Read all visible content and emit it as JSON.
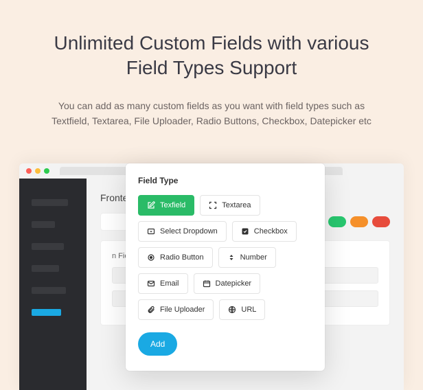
{
  "hero": {
    "title": "Unlimited Custom Fields with various Field Types Support",
    "desc": "You can add as many custom fields as you want with field types such as Textfield, Textarea, File Uploader, Radio Buttons, Checkbox, Datepicker etc"
  },
  "app": {
    "heading_prefix": "Fronte",
    "form_label_fragment": "n Field"
  },
  "popover": {
    "title": "Field Type",
    "add_label": "Add",
    "options": {
      "textfield": "Texfield",
      "textarea": "Textarea",
      "select_dropdown": "Select Dropdown",
      "checkbox": "Checkbox",
      "radio_button": "Radio Button",
      "number": "Number",
      "email": "Email",
      "datepicker": "Datepicker",
      "file_uploader": "File Uploader",
      "url": "URL"
    }
  }
}
